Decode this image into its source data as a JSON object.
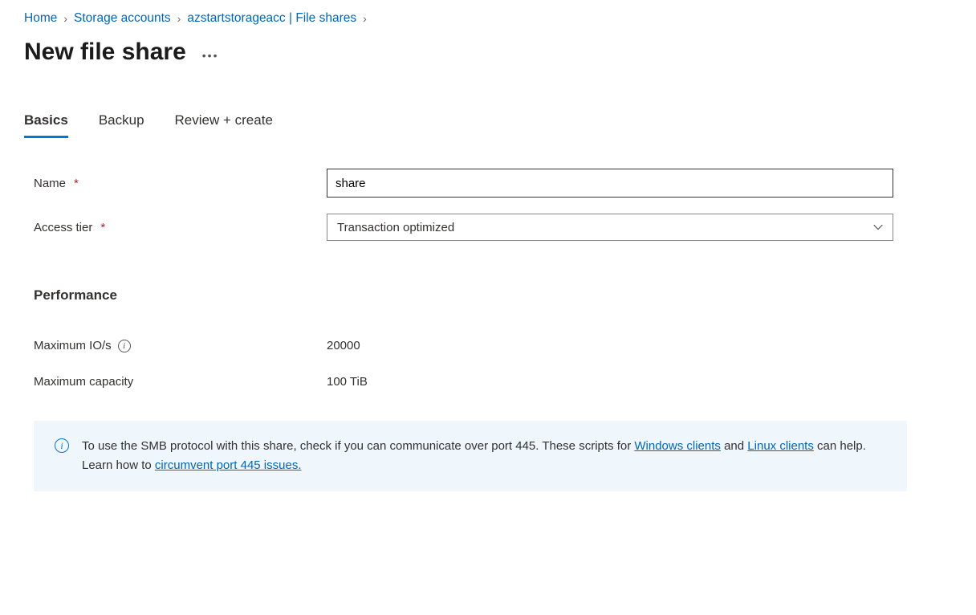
{
  "breadcrumb": {
    "items": [
      {
        "label": "Home"
      },
      {
        "label": "Storage accounts"
      },
      {
        "label": "azstartstorageacc | File shares"
      }
    ]
  },
  "page": {
    "title": "New file share"
  },
  "tabs": {
    "basics": "Basics",
    "backup": "Backup",
    "review": "Review + create"
  },
  "form": {
    "name_label": "Name",
    "name_value": "share",
    "tier_label": "Access tier",
    "tier_value": "Transaction optimized"
  },
  "performance": {
    "heading": "Performance",
    "iops_label": "Maximum IO/s",
    "iops_value": "20000",
    "capacity_label": "Maximum capacity",
    "capacity_value": "100 TiB"
  },
  "info": {
    "text1": "To use the SMB protocol with this share, check if you can communicate over port 445. These scripts for ",
    "link1": "Windows clients",
    "text2": " and ",
    "link2": "Linux clients",
    "text3": " can help. Learn how to ",
    "link3": "circumvent port 445 issues."
  }
}
